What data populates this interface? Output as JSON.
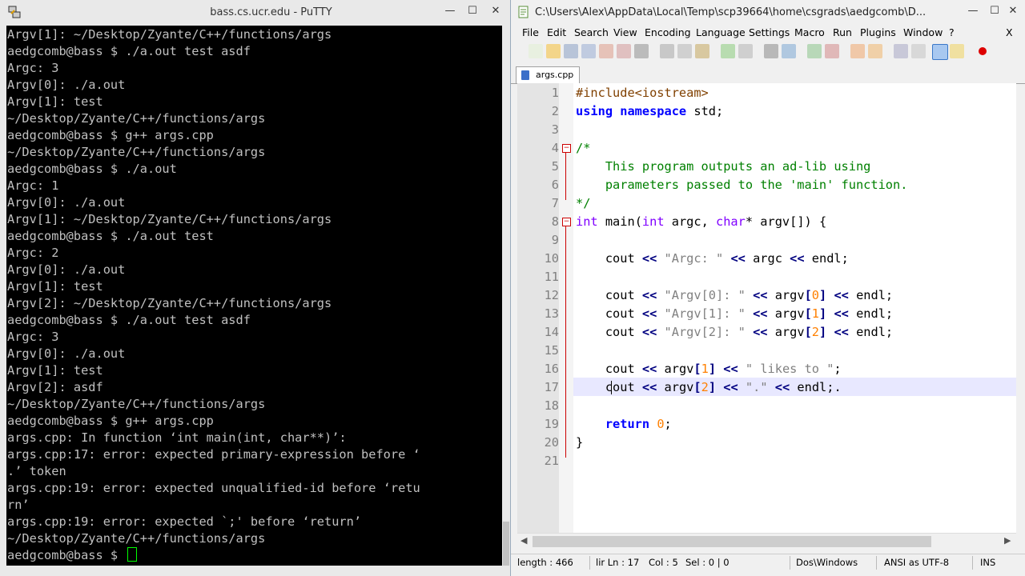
{
  "putty": {
    "title": "bass.cs.ucr.edu - PuTTY",
    "terminal_lines": [
      "Argv[1]: ~/Desktop/Zyante/C++/functions/args",
      "aedgcomb@bass $ ./a.out test asdf",
      "Argc: 3",
      "Argv[0]: ./a.out",
      "Argv[1]: test",
      "~/Desktop/Zyante/C++/functions/args",
      "aedgcomb@bass $ g++ args.cpp",
      "~/Desktop/Zyante/C++/functions/args",
      "aedgcomb@bass $ ./a.out",
      "Argc: 1",
      "Argv[0]: ./a.out",
      "Argv[1]: ~/Desktop/Zyante/C++/functions/args",
      "aedgcomb@bass $ ./a.out test",
      "Argc: 2",
      "Argv[0]: ./a.out",
      "Argv[1]: test",
      "Argv[2]: ~/Desktop/Zyante/C++/functions/args",
      "aedgcomb@bass $ ./a.out test asdf",
      "Argc: 3",
      "Argv[0]: ./a.out",
      "Argv[1]: test",
      "Argv[2]: asdf",
      "~/Desktop/Zyante/C++/functions/args",
      "aedgcomb@bass $ g++ args.cpp",
      "args.cpp: In function ‘int main(int, char**)’:",
      "args.cpp:17: error: expected primary-expression before ‘",
      ".’ token",
      "args.cpp:19: error: expected unqualified-id before ‘retu",
      "rn’",
      "args.cpp:19: error: expected `;' before ‘return’",
      "~/Desktop/Zyante/C++/functions/args"
    ],
    "prompt": "aedgcomb@bass $ "
  },
  "npp": {
    "title": "C:\\Users\\Alex\\AppData\\Local\\Temp\\scp39664\\home\\csgrads\\aedgcomb\\D...",
    "menu": [
      "File",
      "Edit",
      "Search",
      "View",
      "Encoding",
      "Language",
      "Settings",
      "Macro",
      "Run",
      "Plugins",
      "Window",
      "?"
    ],
    "close_x": "X",
    "tab_label": "args.cpp",
    "line_numbers": [
      "1",
      "2",
      "3",
      "4",
      "5",
      "6",
      "7",
      "8",
      "9",
      "10",
      "11",
      "12",
      "13",
      "14",
      "15",
      "16",
      "17",
      "18",
      "19",
      "20",
      "21"
    ],
    "code": {
      "l1": "#include<iostream>",
      "l2_kw": "using namespace",
      "l2_rest": " std;",
      "l4": "/*",
      "l5": "    This program outputs an ad-lib using",
      "l6": "    parameters passed to the 'main' function.",
      "l7": "*/",
      "int": "int",
      "main": " main(",
      "argc": " argc, ",
      "char": "char",
      "argv": "* argv[]) {",
      "cout": "cout",
      "shl": "<<",
      "argc_str": "\"Argc: \"",
      "argv0_str": "\"Argv[0]: \"",
      "argv1_str": "\"Argv[1]: \"",
      "argv2_str": "\"Argv[2]: \"",
      "likes_str": "\" likes to \"",
      "dot_str": "\".\"",
      "argc_id": "argc",
      "argv_id": "argv",
      "endl": "endl;",
      "endl_err": "endl;.",
      "n0": "0",
      "n1": "1",
      "n2": "2",
      "lb": "[",
      "rb": "]",
      "ret": "return",
      "close_brace": "}",
      "semi": ";"
    },
    "status": {
      "length": "length : 466",
      "ln": "lir Ln : 17",
      "col": "Col : 5",
      "sel": "Sel : 0 | 0",
      "eol": "Dos\\Windows",
      "encoding": "ANSI as UTF-8",
      "ins": "INS"
    }
  }
}
